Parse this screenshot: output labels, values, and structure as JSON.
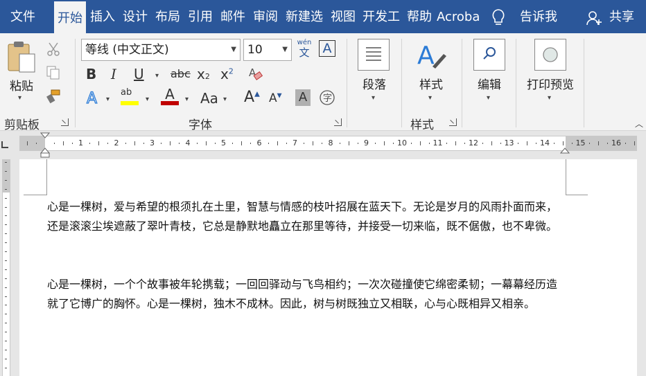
{
  "tabs": [
    {
      "label": "文件"
    },
    {
      "label": "开始"
    },
    {
      "label": "插入"
    },
    {
      "label": "设计"
    },
    {
      "label": "布局"
    },
    {
      "label": "引用"
    },
    {
      "label": "邮件"
    },
    {
      "label": "审阅"
    },
    {
      "label": "新建选"
    },
    {
      "label": "视图"
    },
    {
      "label": "开发工"
    },
    {
      "label": "帮助"
    },
    {
      "label": "Acroba"
    },
    {
      "label": "告诉我"
    },
    {
      "label": "共享"
    }
  ],
  "clipboard": {
    "paste_label": "粘贴",
    "group_label": "剪贴板"
  },
  "font": {
    "name": "等线 (中文正文)",
    "size": "10",
    "group_label": "字体",
    "phonetic": "wén",
    "phonetic_char": "文",
    "highlight_ab": "ab",
    "case_label": "Aa"
  },
  "paragraph": {
    "label": "段落"
  },
  "styles": {
    "label": "样式",
    "group_label": "样式"
  },
  "editing": {
    "label": "编辑"
  },
  "print_preview": {
    "label": "打印预览"
  },
  "ruler": {
    "ticks": [
      "2",
      "1",
      "1",
      "2",
      "3",
      "4",
      "5",
      "6",
      "7",
      "8",
      "9",
      "10",
      "11",
      "12",
      "13",
      "14",
      "15",
      "16"
    ]
  },
  "document": {
    "paragraphs": [
      "心是一棵树，爱与希望的根须扎在土里，智慧与情感的枝叶招展在蓝天下。无论是岁月的风雨扑面而来，还是滚滚尘埃遮蔽了翠叶青枝，它总是静默地矗立在那里等待，并接受一切来临，既不倨傲，也不卑微。",
      "心是一棵树，一个个故事被年轮携载；一回回驿动与飞鸟相约；一次次碰撞使它绵密柔韧；一幕幕经历造就了它博广的胸怀。心是一棵树，独木不成林。因此，树与树既独立又相联，心与心既相异又相亲。"
    ]
  },
  "colors": {
    "accent": "#2b579a",
    "font_color": "#c00000",
    "highlight": "#ffff00"
  }
}
